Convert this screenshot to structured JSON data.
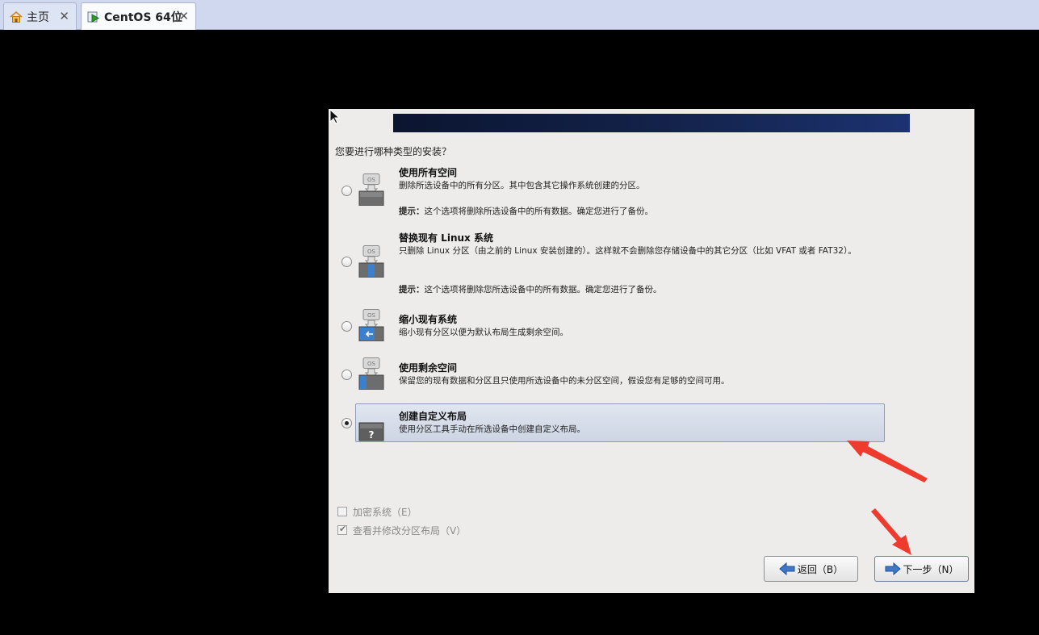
{
  "tabs": [
    {
      "label": "主页",
      "icon": "home-icon"
    },
    {
      "label": "CentOS 64位",
      "icon": "vm-running-icon"
    }
  ],
  "installer": {
    "question": "您要进行哪种类型的安装？",
    "options": [
      {
        "title": "使用所有空间",
        "desc": "删除所选设备中的所有分区。其中包含其它操作系统创建的分区。",
        "hint_label": "提示：",
        "hint_text": "这个选项将删除所选设备中的所有数据。确定您进行了备份。",
        "selected": false
      },
      {
        "title": "替换现有 Linux 系统",
        "desc": "只删除 Linux 分区（由之前的 Linux 安装创建的）。这样就不会删除您存储设备中的其它分区（比如 VFAT 或者 FAT32）。",
        "hint_label": "提示：",
        "hint_text": "这个选项将删除您所选设备中的所有数据。确定您进行了备份。",
        "selected": false
      },
      {
        "title": "缩小现有系统",
        "desc": "缩小现有分区以便为默认布局生成剩余空间。",
        "selected": false
      },
      {
        "title": "使用剩余空间",
        "desc": "保留您的现有数据和分区且只使用所选设备中的未分区空间，假设您有足够的空间可用。",
        "selected": false
      },
      {
        "title": "创建自定义布局",
        "desc": "使用分区工具手动在所选设备中创建自定义布局。",
        "selected": true
      }
    ],
    "encrypt_label": "加密系统（E）",
    "encrypt_checked": false,
    "review_label": "查看并修改分区布局（V）",
    "review_checked": true,
    "back_label": "返回（B）",
    "next_label": "下一步（N）"
  },
  "colors": {
    "banner": "#14234c",
    "selection": "#cdd5e4",
    "annotation_arrow": "#ee3b2e"
  }
}
